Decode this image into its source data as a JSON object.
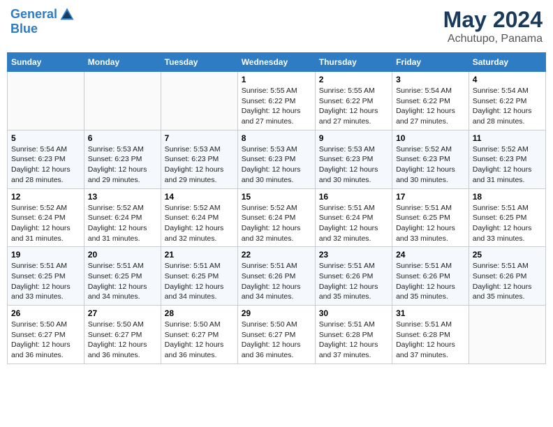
{
  "header": {
    "logo_line1": "General",
    "logo_line2": "Blue",
    "month_year": "May 2024",
    "location": "Achutupo, Panama"
  },
  "days_of_week": [
    "Sunday",
    "Monday",
    "Tuesday",
    "Wednesday",
    "Thursday",
    "Friday",
    "Saturday"
  ],
  "weeks": [
    [
      {
        "day": "",
        "info": ""
      },
      {
        "day": "",
        "info": ""
      },
      {
        "day": "",
        "info": ""
      },
      {
        "day": "1",
        "info": "Sunrise: 5:55 AM\nSunset: 6:22 PM\nDaylight: 12 hours and 27 minutes."
      },
      {
        "day": "2",
        "info": "Sunrise: 5:55 AM\nSunset: 6:22 PM\nDaylight: 12 hours and 27 minutes."
      },
      {
        "day": "3",
        "info": "Sunrise: 5:54 AM\nSunset: 6:22 PM\nDaylight: 12 hours and 27 minutes."
      },
      {
        "day": "4",
        "info": "Sunrise: 5:54 AM\nSunset: 6:22 PM\nDaylight: 12 hours and 28 minutes."
      }
    ],
    [
      {
        "day": "5",
        "info": "Sunrise: 5:54 AM\nSunset: 6:23 PM\nDaylight: 12 hours and 28 minutes."
      },
      {
        "day": "6",
        "info": "Sunrise: 5:53 AM\nSunset: 6:23 PM\nDaylight: 12 hours and 29 minutes."
      },
      {
        "day": "7",
        "info": "Sunrise: 5:53 AM\nSunset: 6:23 PM\nDaylight: 12 hours and 29 minutes."
      },
      {
        "day": "8",
        "info": "Sunrise: 5:53 AM\nSunset: 6:23 PM\nDaylight: 12 hours and 30 minutes."
      },
      {
        "day": "9",
        "info": "Sunrise: 5:53 AM\nSunset: 6:23 PM\nDaylight: 12 hours and 30 minutes."
      },
      {
        "day": "10",
        "info": "Sunrise: 5:52 AM\nSunset: 6:23 PM\nDaylight: 12 hours and 30 minutes."
      },
      {
        "day": "11",
        "info": "Sunrise: 5:52 AM\nSunset: 6:23 PM\nDaylight: 12 hours and 31 minutes."
      }
    ],
    [
      {
        "day": "12",
        "info": "Sunrise: 5:52 AM\nSunset: 6:24 PM\nDaylight: 12 hours and 31 minutes."
      },
      {
        "day": "13",
        "info": "Sunrise: 5:52 AM\nSunset: 6:24 PM\nDaylight: 12 hours and 31 minutes."
      },
      {
        "day": "14",
        "info": "Sunrise: 5:52 AM\nSunset: 6:24 PM\nDaylight: 12 hours and 32 minutes."
      },
      {
        "day": "15",
        "info": "Sunrise: 5:52 AM\nSunset: 6:24 PM\nDaylight: 12 hours and 32 minutes."
      },
      {
        "day": "16",
        "info": "Sunrise: 5:51 AM\nSunset: 6:24 PM\nDaylight: 12 hours and 32 minutes."
      },
      {
        "day": "17",
        "info": "Sunrise: 5:51 AM\nSunset: 6:25 PM\nDaylight: 12 hours and 33 minutes."
      },
      {
        "day": "18",
        "info": "Sunrise: 5:51 AM\nSunset: 6:25 PM\nDaylight: 12 hours and 33 minutes."
      }
    ],
    [
      {
        "day": "19",
        "info": "Sunrise: 5:51 AM\nSunset: 6:25 PM\nDaylight: 12 hours and 33 minutes."
      },
      {
        "day": "20",
        "info": "Sunrise: 5:51 AM\nSunset: 6:25 PM\nDaylight: 12 hours and 34 minutes."
      },
      {
        "day": "21",
        "info": "Sunrise: 5:51 AM\nSunset: 6:25 PM\nDaylight: 12 hours and 34 minutes."
      },
      {
        "day": "22",
        "info": "Sunrise: 5:51 AM\nSunset: 6:26 PM\nDaylight: 12 hours and 34 minutes."
      },
      {
        "day": "23",
        "info": "Sunrise: 5:51 AM\nSunset: 6:26 PM\nDaylight: 12 hours and 35 minutes."
      },
      {
        "day": "24",
        "info": "Sunrise: 5:51 AM\nSunset: 6:26 PM\nDaylight: 12 hours and 35 minutes."
      },
      {
        "day": "25",
        "info": "Sunrise: 5:51 AM\nSunset: 6:26 PM\nDaylight: 12 hours and 35 minutes."
      }
    ],
    [
      {
        "day": "26",
        "info": "Sunrise: 5:50 AM\nSunset: 6:27 PM\nDaylight: 12 hours and 36 minutes."
      },
      {
        "day": "27",
        "info": "Sunrise: 5:50 AM\nSunset: 6:27 PM\nDaylight: 12 hours and 36 minutes."
      },
      {
        "day": "28",
        "info": "Sunrise: 5:50 AM\nSunset: 6:27 PM\nDaylight: 12 hours and 36 minutes."
      },
      {
        "day": "29",
        "info": "Sunrise: 5:50 AM\nSunset: 6:27 PM\nDaylight: 12 hours and 36 minutes."
      },
      {
        "day": "30",
        "info": "Sunrise: 5:51 AM\nSunset: 6:28 PM\nDaylight: 12 hours and 37 minutes."
      },
      {
        "day": "31",
        "info": "Sunrise: 5:51 AM\nSunset: 6:28 PM\nDaylight: 12 hours and 37 minutes."
      },
      {
        "day": "",
        "info": ""
      }
    ]
  ]
}
